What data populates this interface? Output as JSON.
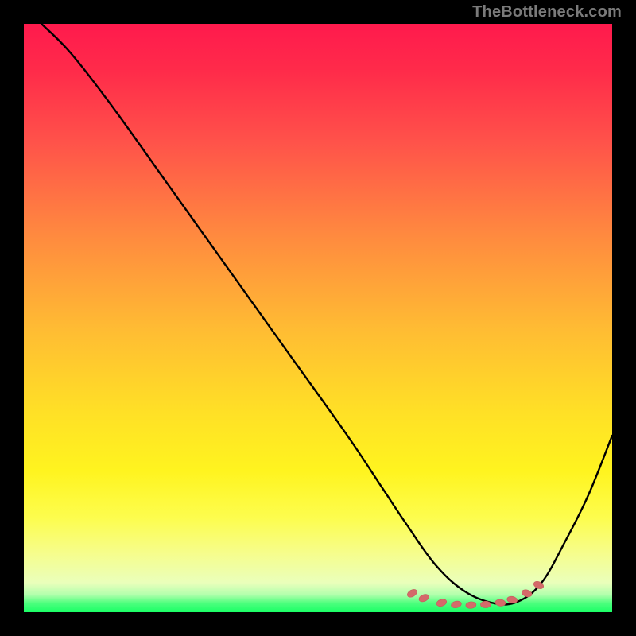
{
  "attribution": "TheBottleneck.com",
  "colors": {
    "background": "#000000",
    "attribution_text": "#7a7a7a",
    "curve": "#000000",
    "marker_fill": "#d46a6a",
    "marker_stroke": "#c55b5b",
    "gradient_top": "#ff1a4d",
    "gradient_bottom": "#1aff66"
  },
  "chart_data": {
    "type": "line",
    "title": "",
    "xlabel": "",
    "ylabel": "",
    "xlim": [
      0,
      100
    ],
    "ylim": [
      0,
      100
    ],
    "series": [
      {
        "name": "bottleneck-curve",
        "x": [
          3,
          8,
          15,
          25,
          35,
          45,
          55,
          61,
          65,
          70,
          75,
          80,
          84,
          88,
          92,
          96,
          100
        ],
        "y": [
          100,
          95,
          86,
          72,
          58,
          44,
          30,
          21,
          15,
          8,
          3.5,
          1.5,
          1.8,
          5,
          12,
          20,
          30
        ]
      }
    ],
    "markers": {
      "name": "bottom-cluster",
      "points": [
        {
          "x": 66,
          "y": 3.2
        },
        {
          "x": 68,
          "y": 2.4
        },
        {
          "x": 71,
          "y": 1.6
        },
        {
          "x": 73.5,
          "y": 1.3
        },
        {
          "x": 76,
          "y": 1.2
        },
        {
          "x": 78.5,
          "y": 1.3
        },
        {
          "x": 81,
          "y": 1.6
        },
        {
          "x": 83,
          "y": 2.1
        },
        {
          "x": 85.5,
          "y": 3.2
        },
        {
          "x": 87.5,
          "y": 4.6
        }
      ]
    }
  }
}
